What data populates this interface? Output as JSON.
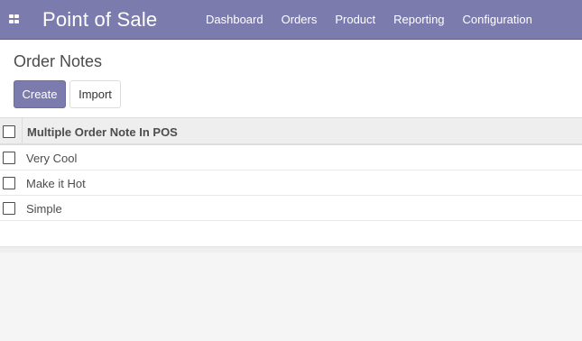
{
  "header": {
    "app_title": "Point of Sale",
    "apps_icon": "grid-apps-icon",
    "menu": [
      {
        "label": "Dashboard"
      },
      {
        "label": "Orders"
      },
      {
        "label": "Product"
      },
      {
        "label": "Reporting"
      },
      {
        "label": "Configuration"
      }
    ],
    "color": "#7c7bad"
  },
  "control_panel": {
    "breadcrumb": "Order Notes",
    "create_label": "Create",
    "import_label": "Import"
  },
  "table": {
    "column_header": "Multiple Order Note In POS",
    "rows": [
      {
        "label": "Very Cool"
      },
      {
        "label": "Make it Hot"
      },
      {
        "label": "Simple"
      }
    ]
  }
}
